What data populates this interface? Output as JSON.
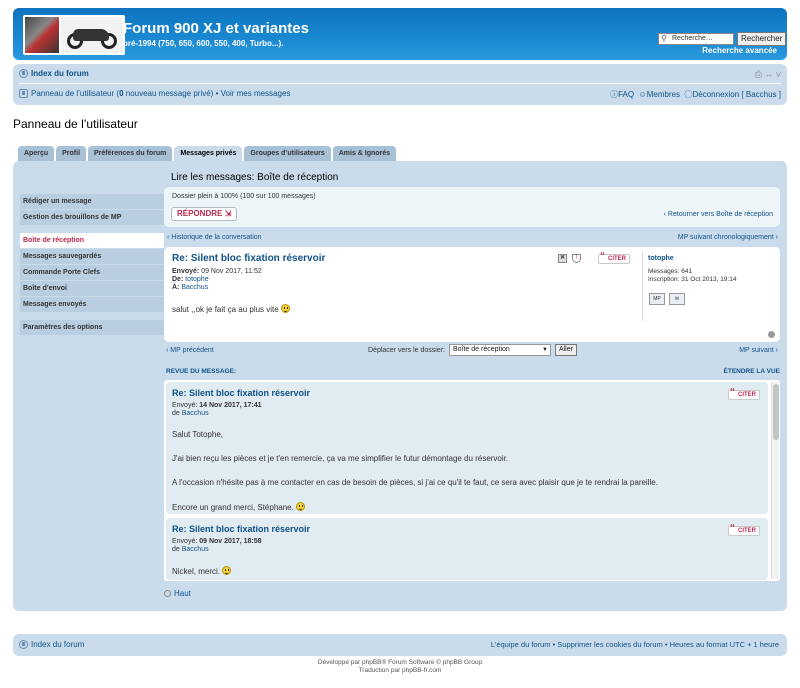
{
  "header": {
    "title": "Forum 900 XJ et variantes",
    "description": "pré-1994 (750, 650, 600, 550, 400, Turbo...).",
    "search_placeholder": "Recherche…",
    "search_button": "Rechercher",
    "advanced_search": "Recherche avancée"
  },
  "navbar": {
    "forum_index": "Index du forum",
    "tools": "⎙ ↔ ∨",
    "ucp_link": "Panneau de l’utilisateur",
    "ucp_pm_open": " (",
    "ucp_pm_count": "0",
    "ucp_pm_text": " nouveau message privé) • ",
    "view_messages": "Voir mes messages",
    "faq": "FAQ",
    "members": "Membres",
    "logout": "Déconnexion [ Bacchus ]"
  },
  "page_title": "Panneau de l’utilisateur",
  "tabs": [
    {
      "label": "Aperçu"
    },
    {
      "label": "Profil"
    },
    {
      "label": "Préférences du forum"
    },
    {
      "label": "Messages privés"
    },
    {
      "label": "Groupes d’utilisateurs"
    },
    {
      "label": "Amis & Ignorés"
    }
  ],
  "menu": {
    "compose": "Rédiger un message",
    "drafts": "Gestion des brouillons de MP",
    "inbox": "Boîte de réception",
    "saved": "Messages sauvegardés",
    "keychain": "Commande Porte Clefs",
    "outbox": "Boîte d’envoi",
    "sent": "Messages envoyés",
    "options": "Paramètres des options"
  },
  "content": {
    "title": "Lire les messages: Boîte de réception",
    "folder_info": "Dossier plein à 100% (100 sur 100 messages)",
    "reply": "RÉPONDRE ⇲",
    "back": "‹ Retourner vers Boîte de réception",
    "history": "‹ Historique de la conversation",
    "next_chrono": "MP suivant chronologiquement ›"
  },
  "message": {
    "subject": "Re: Silent bloc fixation réservoir",
    "sent_label": "Envoyé:",
    "sent": "09 Nov 2017, 11:52",
    "from_label": "De:",
    "from": "totophe",
    "to_label": "À:",
    "to": "Bacchus",
    "body": "salut ,,ok je fait ça au plus vite ",
    "quote": "CITER",
    "author": "totophe",
    "posts": "Messages: 641",
    "joined": "Inscription: 31 Oct 2013, 19:14",
    "pm_btn": "MP",
    "mail_btn": "✉",
    "delete_icon": "✖",
    "report_icon": "!"
  },
  "move": {
    "prev": "‹ MP précédent",
    "label": "Déplacer vers le dossier:",
    "selected": "Boîte de réception",
    "go": "Aller",
    "next": "MP suivant ›"
  },
  "review": {
    "header": "REVUE DU MESSAGE:",
    "expand": "ÉTENDRE LA VUE",
    "posts": [
      {
        "subject": "Re: Silent bloc fixation réservoir",
        "sent_label": "Envoyé: ",
        "sent": "14 Nov 2017, 17:41",
        "by": "de ",
        "author": "Bacchus",
        "lines": [
          "Salut Totophe,",
          "J'ai bien reçu les pièces et je t'en remercie, ça va me simplifier le futur démontage du réservoir.",
          "A l'occasion n'hésite pas à me contacter en cas de besoin de pièces, si j'ai ce qu'il te faut, ce sera avec plaisir que je te rendrai la pareille.",
          "Encore un grand merci, Stéphane. "
        ]
      },
      {
        "subject": "Re: Silent bloc fixation réservoir",
        "sent_label": "Envoyé: ",
        "sent": "09 Nov 2017, 18:58",
        "by": "de ",
        "author": "Bacchus",
        "lines": [
          "Nickel, merci. "
        ]
      }
    ],
    "quote": "CITER"
  },
  "top_link": "Haut",
  "footer": {
    "index": "Index du forum",
    "right": "L’équipe du forum • Supprimer les cookies du forum • Heures au format UTC + 1 heure",
    "powered": "Développé par phpBB® Forum Software © phpBB Group",
    "translation": "Traduction par phpBB-fr.com"
  }
}
